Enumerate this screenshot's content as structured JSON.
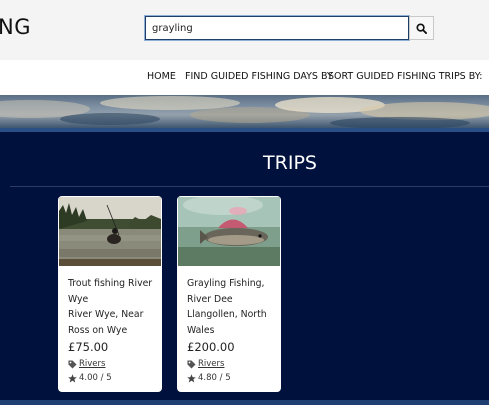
{
  "header": {
    "brand": "NG",
    "search": {
      "value": "grayling",
      "icon": "search-icon"
    }
  },
  "nav": {
    "items": [
      {
        "label": "HOME"
      },
      {
        "label": "FIND GUIDED FISHING DAYS BY"
      },
      {
        "label": "SORT GUIDED FISHING TRIPS BY:"
      }
    ]
  },
  "main": {
    "title": "TRIPS",
    "cards": [
      {
        "title_line1": "Trout fishing River Wye",
        "title_line2": "River Wye, Near Ross on Wye",
        "price": "£75.00",
        "category": "Rivers",
        "rating": "4.00 / 5",
        "image": "angler-in-river-photo"
      },
      {
        "title_line1": "Grayling Fishing, River Dee",
        "title_line2": "Llangollen, North Wales",
        "price": "£200.00",
        "category": "Rivers",
        "rating": "4.80 / 5",
        "image": "underwater-grayling-photo"
      }
    ]
  },
  "colors": {
    "main_bg": "#01113d",
    "topbar_bg": "#f4f4f4",
    "card_bg": "#ffffff"
  }
}
